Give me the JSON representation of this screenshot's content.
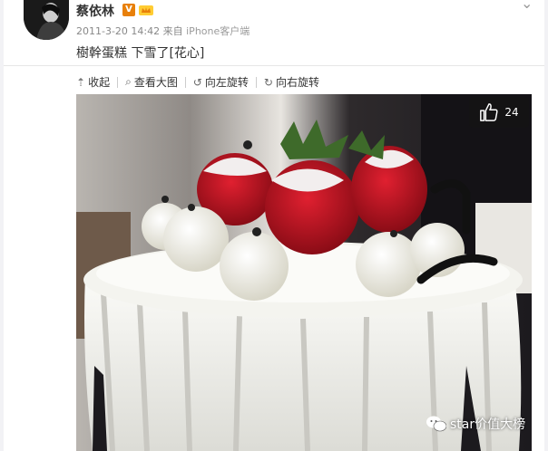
{
  "post": {
    "username": "蔡依林",
    "badge": "V",
    "timestamp": "2011-3-20 14:42",
    "source_prefix": "来自",
    "source": "iPhone客户端",
    "text": "樹幹蛋糕 下雪了[花心]"
  },
  "toolbar": {
    "collapse_label": "收起",
    "view_large_label": "查看大图",
    "rotate_left_label": "向左旋转",
    "rotate_right_label": "向右旋转"
  },
  "image": {
    "like_count": "24"
  },
  "watermark": {
    "text": "star价值大榜"
  },
  "colors": {
    "badge": "#e8800a",
    "text": "#333333",
    "meta": "#888888"
  },
  "icons": {
    "collapse": "arrow-up-icon",
    "view_large": "magnify-icon",
    "rotate_left": "rotate-left-icon",
    "rotate_right": "rotate-right-icon",
    "like": "thumbs-up-icon",
    "close": "close-icon"
  }
}
